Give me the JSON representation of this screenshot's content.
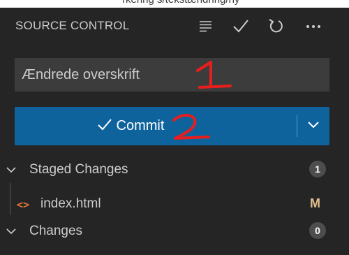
{
  "top_caption": "rkering s/tekstændring/ny",
  "header": {
    "title": "SOURCE CONTROL",
    "icons": [
      "view-as-list-icon",
      "check-icon",
      "refresh-icon",
      "more-actions-icon"
    ]
  },
  "commit_message": {
    "value": "Ændrede overskrift",
    "placeholder": ""
  },
  "commit_button": {
    "label": "Commit",
    "icon": "check-icon",
    "dropdown_icon": "chevron-down-icon"
  },
  "annotations": [
    "1",
    "2"
  ],
  "staged_changes": {
    "label": "Staged Changes",
    "count": "1",
    "files": [
      {
        "name": "index.html",
        "status": "M",
        "icon": "html-file-icon"
      }
    ]
  },
  "changes": {
    "label": "Changes",
    "count": "0"
  },
  "colors": {
    "panel_bg": "#252526",
    "input_bg": "#3c3c3c",
    "button_bg": "#0e639c",
    "annotation": "#e81e1e",
    "modified": "#e2c08d",
    "html_icon": "#e37933"
  }
}
